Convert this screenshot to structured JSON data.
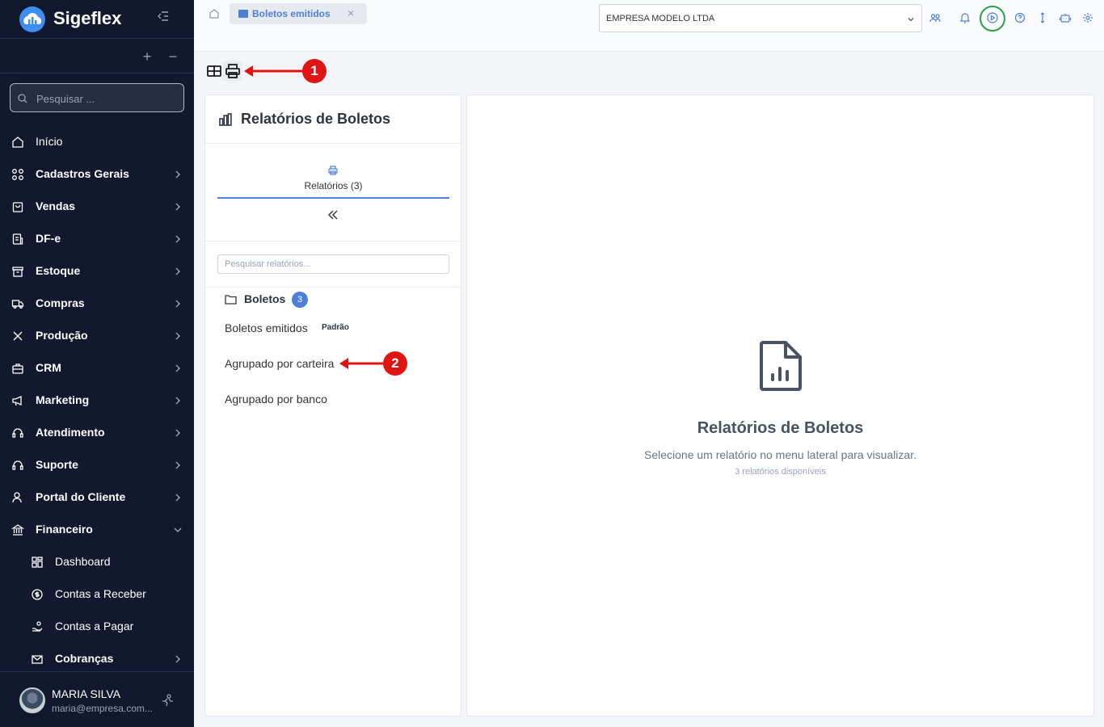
{
  "app": {
    "name": "Sigeflex"
  },
  "sidebar": {
    "search_placeholder": "Pesquisar ...",
    "plus": "+",
    "minus": "−",
    "items": [
      {
        "label": "Início"
      },
      {
        "label": "Cadastros Gerais"
      },
      {
        "label": "Vendas"
      },
      {
        "label": "DF-e"
      },
      {
        "label": "Estoque"
      },
      {
        "label": "Compras"
      },
      {
        "label": "Produção"
      },
      {
        "label": "CRM"
      },
      {
        "label": "Marketing"
      },
      {
        "label": "Atendimento"
      },
      {
        "label": "Suporte"
      },
      {
        "label": "Portal do Cliente"
      },
      {
        "label": "Financeiro"
      }
    ],
    "sub_items": [
      {
        "label": "Dashboard"
      },
      {
        "label": "Contas a Receber"
      },
      {
        "label": "Contas a Pagar"
      },
      {
        "label": "Cobranças"
      }
    ],
    "user": {
      "name": "MARIA SILVA",
      "email": "maria@empresa.com..."
    }
  },
  "topbar": {
    "tab_label": "Boletos emitidos",
    "tab_close": "×",
    "company": "EMPRESA MODELO LTDA"
  },
  "annotations": {
    "callout_1": "1",
    "callout_2": "2"
  },
  "reports_panel": {
    "title": "Relatórios de Boletos",
    "tab_label": "Relatórios (3)",
    "search_placeholder": "Pesquisar relatórios...",
    "group": {
      "name": "Boletos",
      "count": "3"
    },
    "items": [
      {
        "name": "Boletos emitidos",
        "badge": "Padrão"
      },
      {
        "name": "Agrupado por carteira"
      },
      {
        "name": "Agrupado por banco"
      }
    ]
  },
  "empty_state": {
    "title": "Relatórios de Boletos",
    "subtitle": "Selecione um relatório no menu lateral para visualizar.",
    "count": "3 relatórios disponíveis"
  },
  "colors": {
    "sidebar_bg": "#12192e",
    "accent": "#4e7fd8",
    "callout": "#e01414",
    "highlight": "#27a145"
  }
}
